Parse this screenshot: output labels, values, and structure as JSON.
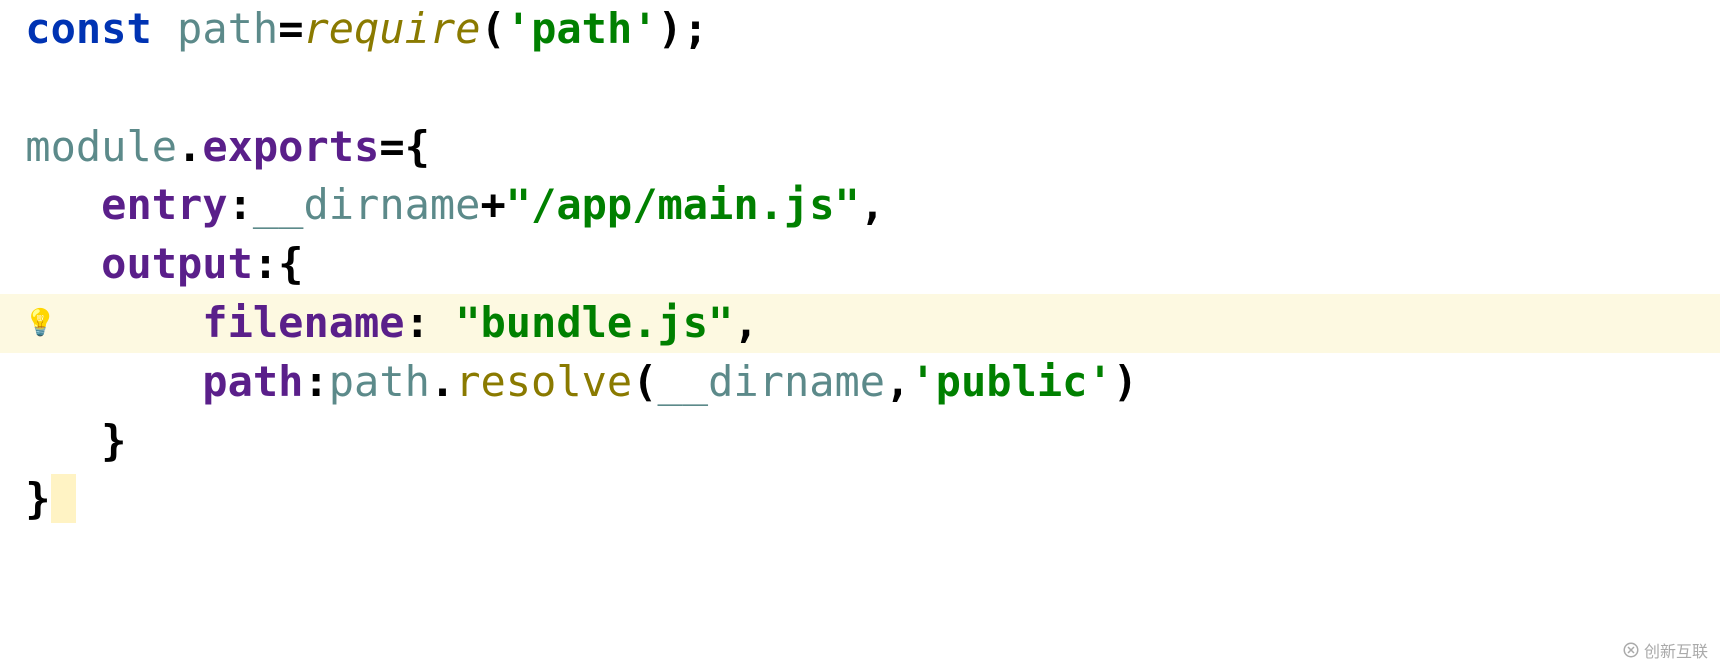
{
  "code": {
    "line1": {
      "kw": "const",
      "var": "path",
      "eq": "=",
      "func": "require",
      "paren_open": "(",
      "arg": "'path'",
      "paren_close": ")",
      "semi": ";"
    },
    "line2": "",
    "line3": {
      "obj": "module",
      "dot": ".",
      "prop": "exports",
      "eq": "=",
      "brace": "{"
    },
    "line4": {
      "indent": "    ",
      "prop": "entry",
      "colon": ":",
      "builtin": "__dirname",
      "plus": "+",
      "str": "\"/app/main.js\"",
      "comma": ","
    },
    "line5": {
      "indent": "    ",
      "prop": "output",
      "colon": ":",
      "brace": "{"
    },
    "line6": {
      "indent": "        ",
      "prop": "filename",
      "colon": ":",
      "space": " ",
      "str": "\"bundle.js\"",
      "comma": ","
    },
    "line7": {
      "indent": "        ",
      "prop": "path",
      "colon": ":",
      "obj": "path",
      "dot": ".",
      "method": "resolve",
      "paren_open": "(",
      "builtin": "__dirname",
      "comma": ",",
      "str": "'public'",
      "paren_close": ")"
    },
    "line8": {
      "indent": "    ",
      "brace": "}"
    },
    "line9": {
      "brace": "}"
    }
  },
  "watermark": "创新互联"
}
